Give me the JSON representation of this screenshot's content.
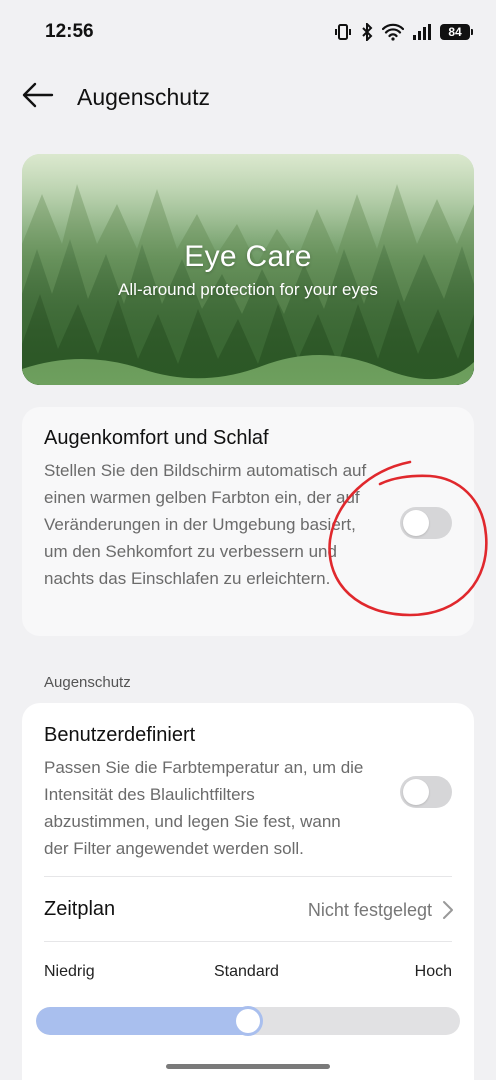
{
  "status_bar": {
    "time": "12:56",
    "battery": "84",
    "icons": [
      "vibrate-icon",
      "bluetooth-icon",
      "wifi-icon",
      "signal-icon",
      "battery-icon"
    ]
  },
  "header": {
    "title": "Augenschutz",
    "back_icon": "arrow-left-icon"
  },
  "hero": {
    "title": "Eye Care",
    "subtitle": "All-around protection for your eyes"
  },
  "comfort_card": {
    "title": "Augenkomfort und Schlaf",
    "description": "Stellen Sie den Bildschirm automatisch auf einen warmen gelben Farbton ein, der auf Veränderungen in der Umgebung basiert, um den Sehkomfort zu verbessern und nachts das Einschlafen zu erleichtern.",
    "toggle_on": false
  },
  "section_label": "Augenschutz",
  "custom_card": {
    "title": "Benutzerdefiniert",
    "description": "Passen Sie die Farbtemperatur an, um die Intensität des Blaulichtfilters abzustimmen, und legen Sie fest, wann der Filter angewendet werden soll.",
    "toggle_on": false,
    "schedule_label": "Zeitplan",
    "schedule_value": "Nicht festgelegt",
    "slider_labels": {
      "low": "Niedrig",
      "mid": "Standard",
      "high": "Hoch"
    },
    "slider_value": 0.5
  },
  "colors": {
    "accent": "#a9bfee",
    "background": "#f1f1f3",
    "annotation": "#e0282d"
  }
}
